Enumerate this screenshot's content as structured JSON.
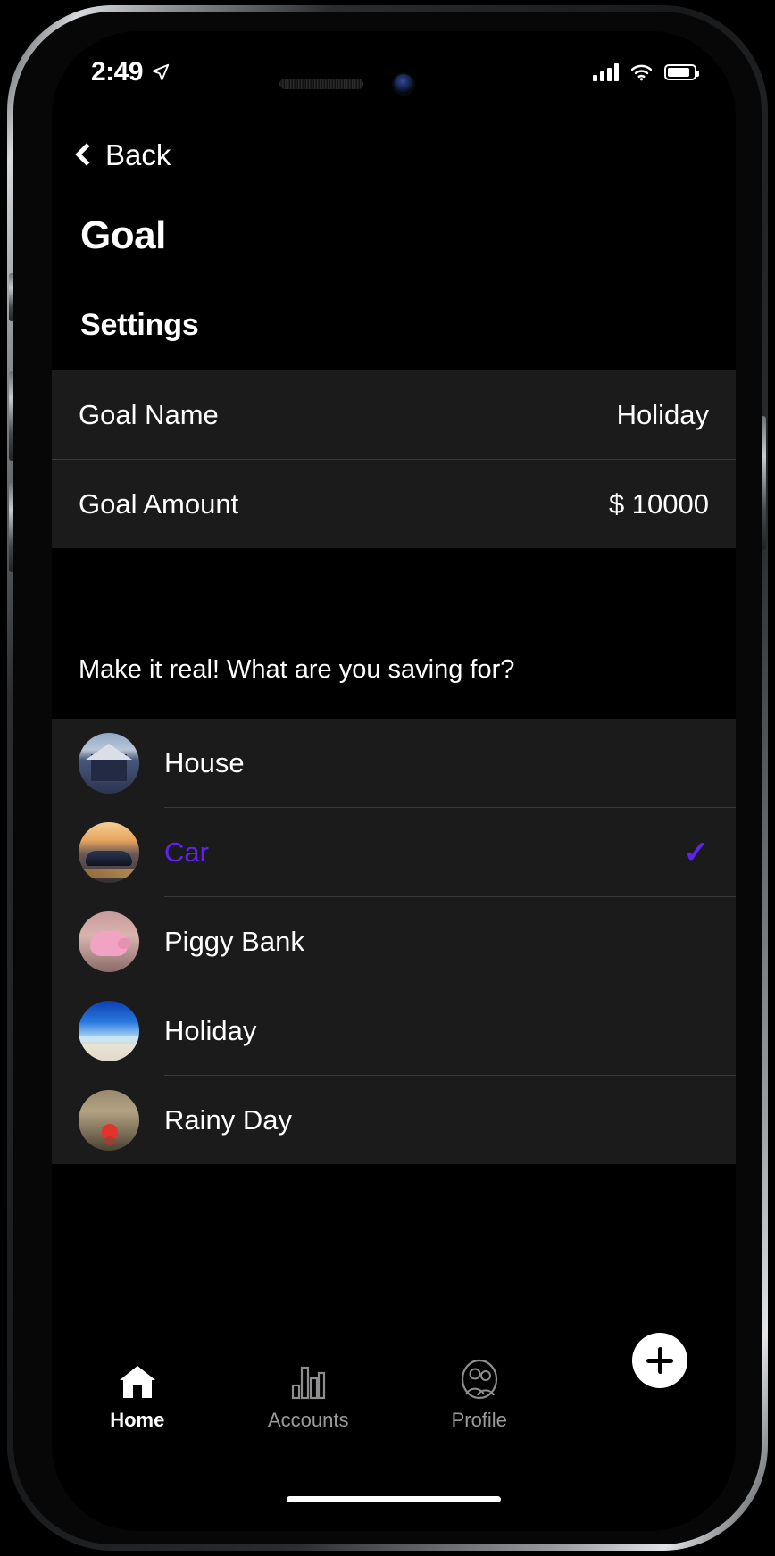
{
  "status_bar": {
    "time": "2:49",
    "location_icon": "location-arrow-icon",
    "signal_icon": "cellular-signal-icon",
    "wifi_icon": "wifi-icon",
    "battery_icon": "battery-icon"
  },
  "nav": {
    "back_label": "Back",
    "back_icon": "chevron-left-icon"
  },
  "header": {
    "title": "Goal",
    "section_title": "Settings"
  },
  "settings": {
    "rows": [
      {
        "label": "Goal Name",
        "value": "Holiday"
      },
      {
        "label": "Goal Amount",
        "value": "$ 10000"
      }
    ]
  },
  "helper_text": "Make it real! What are you saving for?",
  "goal_list": {
    "selected_color": "#6122f0",
    "check_icon": "check-icon",
    "items": [
      {
        "label": "House",
        "avatar": "house-avatar",
        "selected": false
      },
      {
        "label": "Car",
        "avatar": "car-avatar",
        "selected": true
      },
      {
        "label": "Piggy Bank",
        "avatar": "piggy-bank-avatar",
        "selected": false
      },
      {
        "label": "Holiday",
        "avatar": "holiday-beach-avatar",
        "selected": false
      },
      {
        "label": "Rainy Day",
        "avatar": "rainy-day-avatar",
        "selected": false
      }
    ]
  },
  "tab_bar": {
    "items": [
      {
        "label": "Home",
        "icon": "home-icon",
        "active": true
      },
      {
        "label": "Accounts",
        "icon": "bar-chart-icon",
        "active": false
      },
      {
        "label": "Profile",
        "icon": "people-icon",
        "active": false
      }
    ],
    "fab_icon": "plus-icon"
  }
}
